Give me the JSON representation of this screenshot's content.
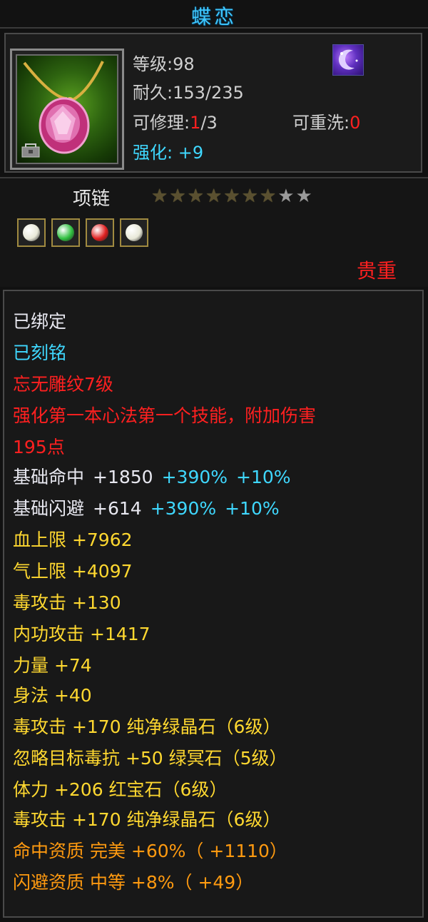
{
  "title": "蝶恋",
  "item": {
    "level_label": "等级",
    "level_value": ":98",
    "durability_label": "耐久",
    "durability_value": ":153/235",
    "repairable_label": "可修理",
    "repairable_current": "1",
    "repairable_total": "/3",
    "rewash_label": "可重洗",
    "rewash_value": "0",
    "enhance_label": "强化",
    "enhance_value": ": +9",
    "type": "项链",
    "stars_total": 9,
    "stars_lit": 7,
    "rarity": "贵重",
    "icon": "necklace-pink-gem-icon",
    "skill_icon": "moon-swirl-skill-icon"
  },
  "gems": [
    {
      "name": "white-diamond-gem",
      "color": "#e8e8d8"
    },
    {
      "name": "green-crystal-gem",
      "color": "#30c040"
    },
    {
      "name": "ruby-gem",
      "color": "#e02020"
    },
    {
      "name": "white-diamond-gem",
      "color": "#e8e8d8"
    }
  ],
  "attributes": {
    "bound": "已绑定",
    "engraved": "已刻铭",
    "pattern": "忘无雕纹7级",
    "effect_line1": "强化第一本心法第一个技能，附加伤害",
    "effect_line2": "195点",
    "hit_label": "基础命中",
    "hit_value": "+1850",
    "hit_bonus1": "+390%",
    "hit_bonus2": "+10%",
    "dodge_label": "基础闪避",
    "dodge_value": "+614",
    "dodge_bonus1": "+390%",
    "dodge_bonus2": "+10%",
    "hp_max": "血上限 +7962",
    "qi_max": "气上限 +4097",
    "poison_attack": "毒攻击 +130",
    "internal_attack": "内功攻击 +1417",
    "strength": "力量 +74",
    "agility": "身法 +40",
    "gem_line1": "毒攻击 +170 纯净绿晶石（6级）",
    "gem_line2": "忽略目标毒抗 +50 绿冥石（5级）",
    "gem_line3": "体力 +206 红宝石（6级）",
    "gem_line4": "毒攻击 +170 纯净绿晶石（6级）",
    "quality_hit": "命中资质  完美 +60%（ +1110）",
    "quality_dodge": "闪避资质  中等 +8%（ +49）"
  },
  "colors": {
    "title": "#3fc8ff",
    "rarity": "#ff2020",
    "blue": "#3fd8ff",
    "yellow": "#ffd830",
    "orange": "#ff9a10"
  }
}
